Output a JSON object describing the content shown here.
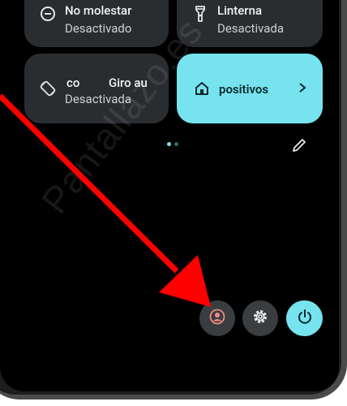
{
  "tiles": {
    "dnd": {
      "title": "No molestar",
      "status": "Desactivado"
    },
    "torch": {
      "title": "Linterna",
      "status": "Desactivada"
    },
    "rotation": {
      "title_part1": "co",
      "title_part2": "Giro au",
      "status": "Desactivada"
    },
    "devices": {
      "title": "positivos"
    }
  },
  "pager": {
    "active_color": "#77e3ef",
    "inactive_color": "#2f6b73"
  },
  "colors": {
    "accent": "#77e3ef",
    "tile_bg": "#2a2d30",
    "user_icon": "#f28b82",
    "arrow": "#ff0000"
  },
  "icons": {
    "dnd": "minus-circle-icon",
    "torch": "flashlight-icon",
    "rotation": "auto-rotate-icon",
    "devices": "home-icon",
    "chevron": "chevron-right-icon",
    "edit": "pencil-icon",
    "user": "user-icon",
    "settings": "gear-icon",
    "power": "power-icon"
  },
  "watermark": "Pantallazo.es"
}
